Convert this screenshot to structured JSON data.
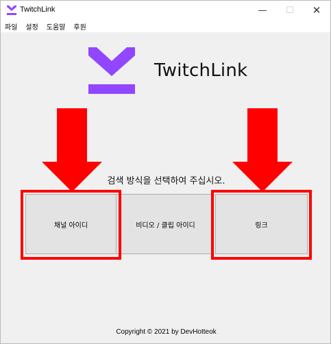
{
  "window": {
    "title": "TwitchLink",
    "minimize_glyph": "—",
    "maximize_glyph": "☐",
    "close_glyph": "✕"
  },
  "menu": {
    "items": [
      "파일",
      "설정",
      "도움말",
      "후원"
    ]
  },
  "logo": {
    "text": "TwitchLink",
    "color": "#9147ff"
  },
  "main": {
    "prompt": "검색 방식을 선택하여 주십시오.",
    "buttons": {
      "channel": "채널 아이디",
      "video": "비디오 / 클립 아이디",
      "link": "링크"
    }
  },
  "annotations": {
    "highlight_color": "#ff0000"
  },
  "footer": {
    "copyright": "Copyright © 2021 by DevHotteok"
  }
}
